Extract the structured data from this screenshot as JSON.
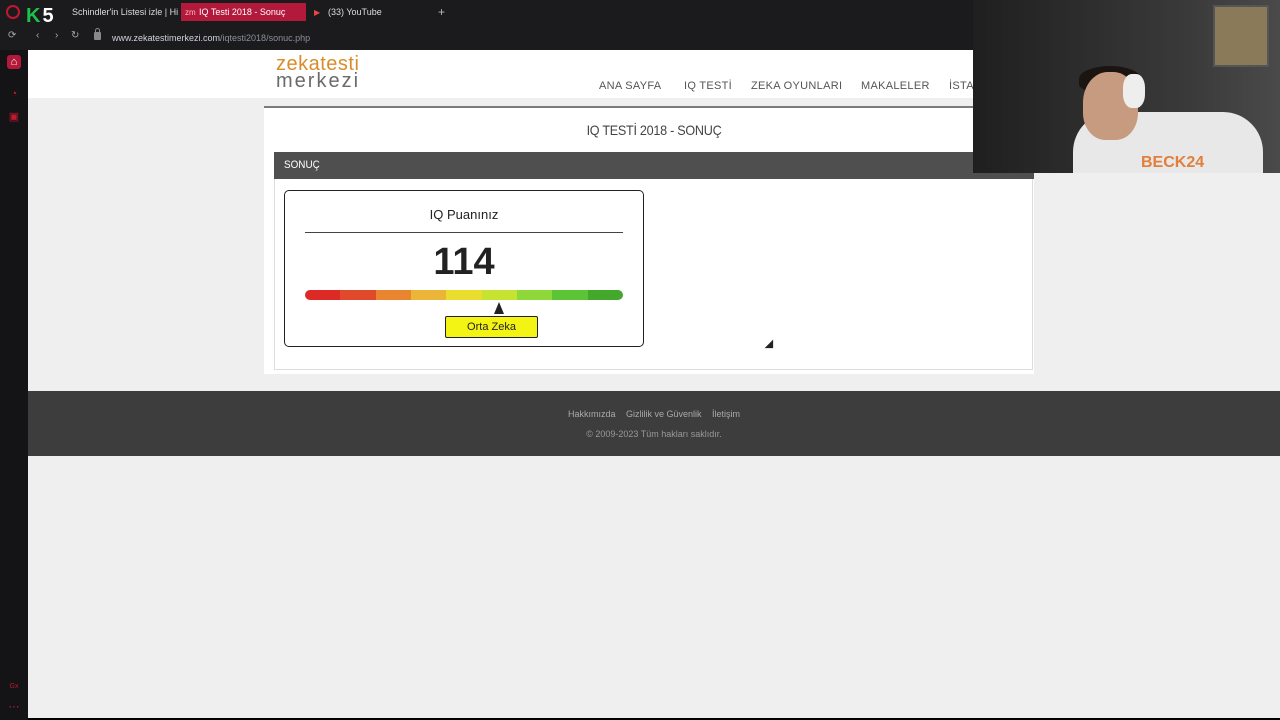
{
  "browser": {
    "tabs": [
      {
        "favicon": "",
        "label": "Schindler'in Listesi izle | Hi"
      },
      {
        "favicon": "zm",
        "label": "IQ Testi 2018 - Sonuç"
      },
      {
        "favicon": "▶",
        "label": "(33) YouTube"
      }
    ],
    "new_tab": "+",
    "url_domain": "www.zekatestimerkezi.com",
    "url_path": "/iqtesti2018/sonuc.php"
  },
  "site": {
    "logo_top": "zekatesti",
    "logo_bottom": "merkezi",
    "menu": [
      "ANA SAYFA",
      "IQ TESTİ",
      "ZEKA OYUNLARI",
      "MAKALELER",
      "İSTAT"
    ]
  },
  "page": {
    "title": "IQ TESTİ 2018 - SONUÇ",
    "section": "SONUÇ"
  },
  "result": {
    "card_title": "IQ Puanınız",
    "score": "114",
    "level": "Orta Zeka",
    "gauge_colors": [
      "#dd2a26",
      "#e04a2a",
      "#e8852e",
      "#ebb637",
      "#e9dd2e",
      "#c6e332",
      "#8fd83a",
      "#5cc535",
      "#43a82b"
    ],
    "pointer_fraction": 0.61
  },
  "footer": {
    "links": [
      "Hakkımızda",
      "Gizlilik ve Güvenlik",
      "İletişim"
    ],
    "copyright": "© 2009-2023 Tüm hakları saklıdır."
  },
  "webcam": {
    "shirt_text": "BECK24"
  }
}
